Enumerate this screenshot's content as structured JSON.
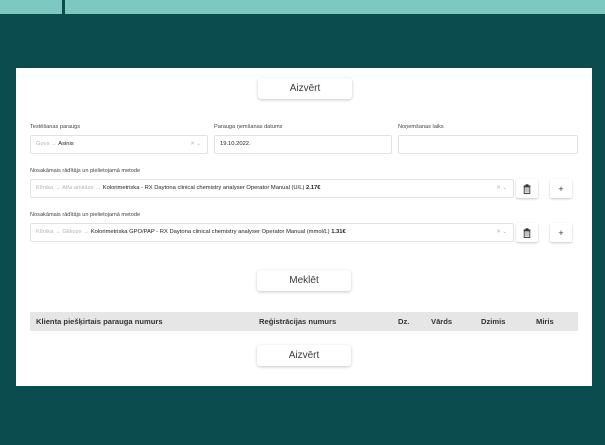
{
  "buttons": {
    "close_top": "Aizvērt",
    "search": "Meklēt",
    "close_bottom": "Aizvērt"
  },
  "form": {
    "test_sample_label": "Testēšanas paraugs",
    "test_sample_value_path": "Govs → ",
    "test_sample_value": "Asinis",
    "sample_date_label": "Parauga ņemšanas datums",
    "sample_date_value": "19.10.2022.",
    "removal_time_label": "Noņemšanas laiks",
    "removal_time_value": ""
  },
  "indicators": [
    {
      "label": "Nosakāmais rādītājs un pielietojamā metode",
      "path": "Klīnika → Alfa amilāze → ",
      "method": "Kolorimetriska - RX Daytona clinical chemistry analyser Operator Manual (U/L) ",
      "price": "2.17€"
    },
    {
      "label": "Nosakāmais rādītājs un pielietojamā metode",
      "path": "Klīnika → Glikoze → ",
      "method": "Kolorimetriska GPO/PAP - RX Daytona clinical chemistry analyser Operator Manual (mmol/L) ",
      "price": "1.31€"
    }
  ],
  "table": {
    "columns": [
      "Klienta piešķirtais parauga numurs",
      "Reģistrācijas numurs",
      "Dz.",
      "Vārds",
      "Dzimis",
      "Miris"
    ]
  },
  "icons": {
    "dropdown": "chevron-down-icon",
    "delete": "trash-icon",
    "add": "plus-icon"
  },
  "colors": {
    "background": "#0b4d4e",
    "accent_strip": "#7ec8c2",
    "panel": "#ffffff",
    "table_header": "#e6e6e6"
  }
}
